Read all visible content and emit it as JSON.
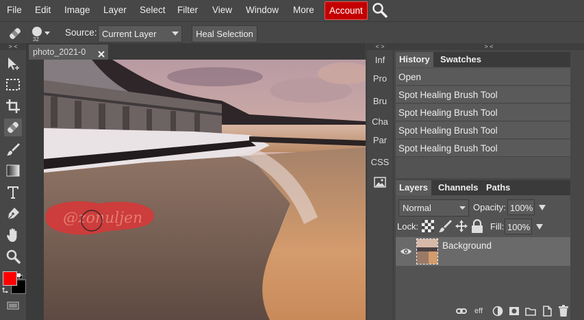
{
  "menubar": {
    "items": [
      "File",
      "Edit",
      "Image",
      "Layer",
      "Select",
      "Filter",
      "View",
      "Window",
      "More"
    ],
    "account_label": "Account"
  },
  "options": {
    "brush_size": "32",
    "source_label": "Source:",
    "source_value": "Current Layer",
    "heal_button": "Heal Selection"
  },
  "panel_collapse_glyphs": {
    "left": "> <",
    "mini": "< >",
    "right": "> <"
  },
  "document": {
    "tab_title": "photo_2021-0",
    "watermark_text": "@zonuljen"
  },
  "mini_panel": {
    "items": [
      "Inf",
      "Pro",
      "Bru",
      "Cha",
      "Par",
      "CSS"
    ]
  },
  "history_panel": {
    "tabs": [
      "History",
      "Swatches"
    ],
    "entries": [
      "Open",
      "Spot Healing Brush Tool",
      "Spot Healing Brush Tool",
      "Spot Healing Brush Tool",
      "Spot Healing Brush Tool"
    ]
  },
  "layers_panel": {
    "tabs": [
      "Layers",
      "Channels",
      "Paths"
    ],
    "blend_mode": "Normal",
    "opacity_label": "Opacity:",
    "opacity_value": "100%",
    "lock_label": "Lock:",
    "fill_label": "Fill:",
    "fill_value": "100%",
    "layer_name": "Background",
    "footer_text": "eff"
  },
  "colors": {
    "foreground": "#ff0000",
    "background": "#000000",
    "account_bg": "#c40000"
  }
}
